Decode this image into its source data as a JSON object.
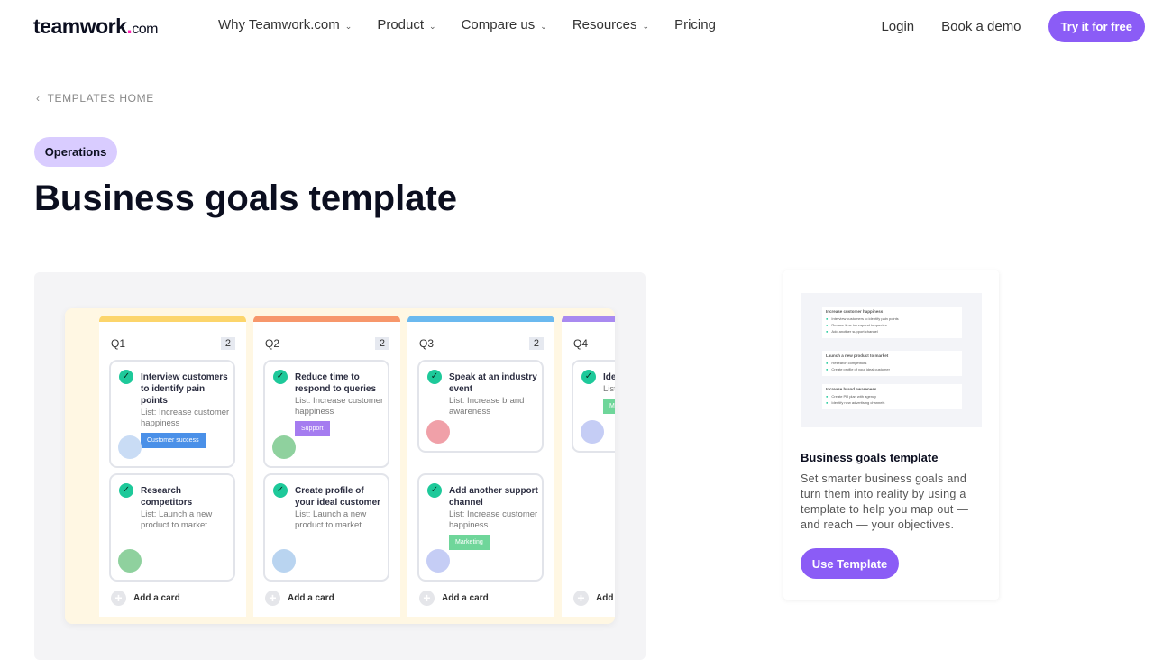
{
  "nav": {
    "logo_main": "teamwork",
    "logo_dot": ".",
    "logo_com": "com",
    "items": [
      "Why Teamwork.com",
      "Product",
      "Compare us",
      "Resources",
      "Pricing"
    ],
    "login": "Login",
    "demo": "Book a demo",
    "try": "Try it for free"
  },
  "back": "TEMPLATES HOME",
  "category": "Operations",
  "title": "Business goals template",
  "board": {
    "add_label": "Add a card",
    "columns": [
      {
        "name": "Q1",
        "count": "2",
        "color": "#fcd56b",
        "cards": [
          {
            "title": "Interview customers to identify pain points",
            "list": "List: Increase customer happiness",
            "tag": "Customer success",
            "tag_color": "#4a90e8",
            "avatar": "#c9dcf5"
          },
          {
            "title": "Research competitors",
            "list": "List: Launch a new product to market",
            "avatar": "#8fd19e"
          }
        ]
      },
      {
        "name": "Q2",
        "count": "2",
        "color": "#f7976b",
        "cards": [
          {
            "title": "Reduce time to respond to queries",
            "list": "List: Increase customer happiness",
            "tag": "Support",
            "tag_color": "#a57cf0",
            "avatar": "#8fd19e"
          },
          {
            "title": "Create profile of your ideal customer",
            "list": "List: Launch a new product to market",
            "avatar": "#b9d4f0"
          }
        ]
      },
      {
        "name": "Q3",
        "count": "2",
        "color": "#6bb9ef",
        "cards": [
          {
            "title": "Speak at an industry event",
            "list": "List: Increase brand awareness",
            "avatar": "#f0a0a8"
          },
          {
            "title": "Add another support channel",
            "list": "List: Increase customer happiness",
            "tag": "Marketing",
            "tag_color": "#6fd69a",
            "avatar": "#c5cdf5"
          }
        ]
      },
      {
        "name": "Q4",
        "count": "",
        "color": "#a98af0",
        "cards": [
          {
            "title": "Ide adv",
            "list": "List aw",
            "tag": "M",
            "tag_color": "#6fd69a",
            "avatar": "#c5cdf5"
          }
        ]
      }
    ]
  },
  "thumb": {
    "groups": [
      {
        "title": "Increase customer happiness",
        "items": [
          "Interview customers to identify pain points",
          "Reduce time to respond to queries",
          "Add another support channel"
        ]
      },
      {
        "title": "Launch a new product to market",
        "items": [
          "Research competitors",
          "Create profile of your ideal customer"
        ]
      },
      {
        "title": "Increase brand awareness",
        "items": [
          "Create PR plan with agency",
          "Identify new advertising channels"
        ]
      }
    ]
  },
  "side": {
    "title": "Business goals template",
    "desc": "Set smarter business goals and turn them into reality by using a template to help you map out — and reach — your objectives.",
    "button": "Use Template"
  }
}
